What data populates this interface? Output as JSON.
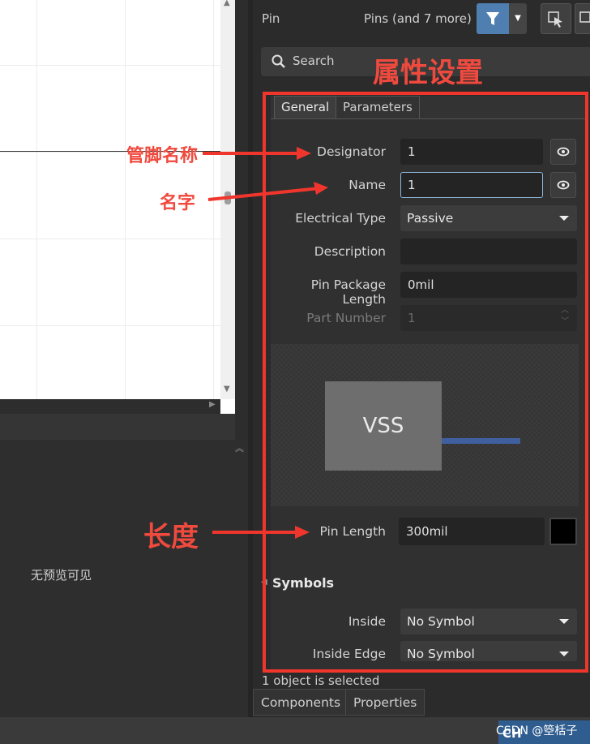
{
  "panel": {
    "title": "Pin",
    "filter_summary": "Pins (and 7 more)",
    "search_placeholder": "Search",
    "tabs": [
      {
        "label": "General",
        "active": true
      },
      {
        "label": "Parameters",
        "active": false
      }
    ],
    "fields": {
      "designator": {
        "label": "Designator",
        "value": "1"
      },
      "name": {
        "label": "Name",
        "value": "1"
      },
      "electrical_type": {
        "label": "Electrical Type",
        "value": "Passive"
      },
      "description": {
        "label": "Description",
        "value": ""
      },
      "pin_package_length": {
        "label": "Pin Package Length",
        "value": "0mil"
      },
      "part_number": {
        "label": "Part Number",
        "value": "1"
      },
      "pin_length": {
        "label": "Pin Length",
        "value": "300mil"
      }
    },
    "preview": {
      "pin_label": "VSS",
      "pin_color": "#3f5f9e"
    },
    "symbols": {
      "heading": "Symbols",
      "inside": {
        "label": "Inside",
        "value": "No Symbol"
      },
      "inside_edge": {
        "label": "Inside Edge",
        "value": "No Symbol"
      }
    },
    "status": "1 object is selected",
    "bottom_tabs": [
      "Components",
      "Properties"
    ]
  },
  "lower_pane": {
    "no_preview_text": "无预览可见"
  },
  "annotations": {
    "title": "属性设置",
    "pin_name": "管脚名称",
    "name": "名字",
    "length": "长度",
    "color": "#f0362c"
  },
  "taskbar": {
    "ime": "CH",
    "watermark": "CSDN @箜栝子"
  },
  "colors": {
    "accent": "#4f7fb0",
    "panel_bg": "#2b2b2b",
    "canvas_bg": "#ffffff"
  }
}
